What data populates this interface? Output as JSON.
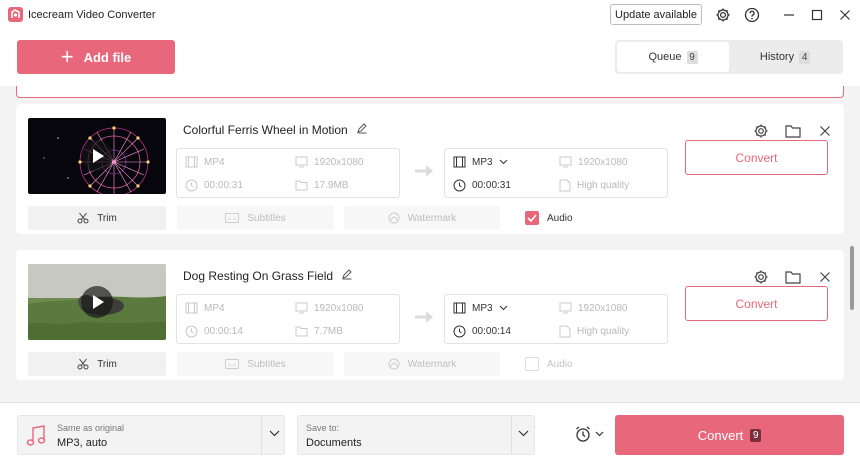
{
  "app": {
    "title": "Icecream Video Converter",
    "update_label": "Update available"
  },
  "header": {
    "add_file_label": "Add file",
    "tabs": [
      {
        "label": "Queue",
        "count": "9",
        "active": true
      },
      {
        "label": "History",
        "count": "4",
        "active": false
      }
    ]
  },
  "items": [
    {
      "title": "Colorful Ferris Wheel in Motion",
      "source": {
        "format": "MP4",
        "resolution": "1920x1080",
        "duration": "00:00:31",
        "size": "17.9MB"
      },
      "target": {
        "format": "MP3",
        "resolution": "1920x1080",
        "duration": "00:00:31",
        "quality": "High quality"
      },
      "convert_label": "Convert",
      "options": {
        "trim": "Trim",
        "subtitles": "Subtitles",
        "watermark": "Watermark",
        "audio": "Audio",
        "audio_checked": true
      }
    },
    {
      "title": "Dog Resting On Grass Field",
      "source": {
        "format": "MP4",
        "resolution": "1920x1080",
        "duration": "00:00:14",
        "size": "7.7MB"
      },
      "target": {
        "format": "MP3",
        "resolution": "1920x1080",
        "duration": "00:00:14",
        "quality": "High quality"
      },
      "convert_label": "Convert",
      "options": {
        "trim": "Trim",
        "subtitles": "Subtitles",
        "watermark": "Watermark",
        "audio": "Audio",
        "audio_checked": false
      }
    }
  ],
  "footer": {
    "format_caption": "Same as original",
    "format_value": "MP3, auto",
    "save_caption": "Save to:",
    "save_value": "Documents",
    "convert_label": "Convert",
    "convert_count": "9"
  },
  "colors": {
    "accent": "#e8677a",
    "background": "#f3f3f3"
  },
  "icons": [
    "settings-icon",
    "help-icon",
    "minimize-icon",
    "maximize-icon",
    "close-icon",
    "edit-icon",
    "folder-icon",
    "film-icon",
    "monitor-icon",
    "clock-icon",
    "file-icon",
    "scissors-icon",
    "subtitles-icon",
    "watermark-icon",
    "music-icon",
    "alarm-icon",
    "chevron-down-icon",
    "arrow-right-icon",
    "play-icon"
  ]
}
